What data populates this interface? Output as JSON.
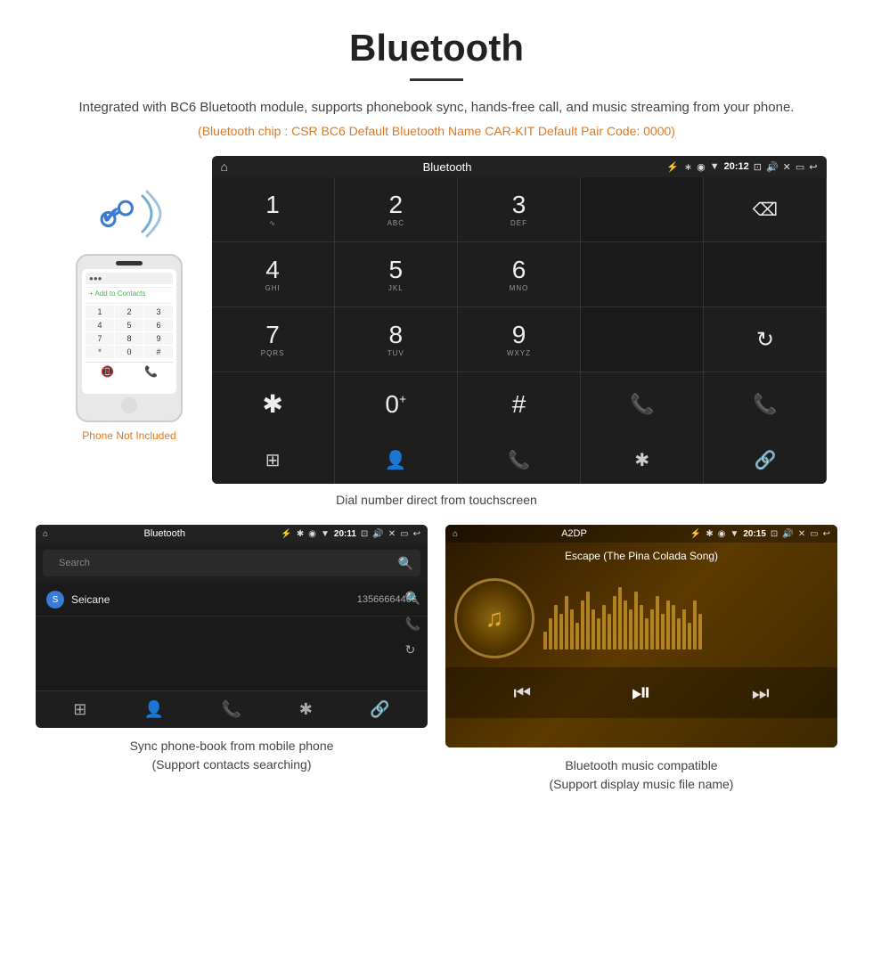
{
  "page": {
    "title": "Bluetooth",
    "subtitle": "Integrated with BC6 Bluetooth module, supports phonebook sync, hands-free call, and music streaming from your phone.",
    "specs": "(Bluetooth chip : CSR BC6    Default Bluetooth Name CAR-KIT    Default Pair Code: 0000)",
    "dial_caption": "Dial number direct from touchscreen",
    "phonebook_caption": "Sync phone-book from mobile phone\n(Support contacts searching)",
    "music_caption": "Bluetooth music compatible\n(Support display music file name)"
  },
  "phone_mockup": {
    "not_included_label": "Phone Not Included"
  },
  "dial_screen": {
    "status_title": "Bluetooth",
    "time": "20:12",
    "keys": [
      {
        "num": "1",
        "sub": ""
      },
      {
        "num": "2",
        "sub": "ABC"
      },
      {
        "num": "3",
        "sub": "DEF"
      },
      {
        "num": "",
        "sub": ""
      },
      {
        "num": "⌫",
        "sub": ""
      },
      {
        "num": "4",
        "sub": "GHI"
      },
      {
        "num": "5",
        "sub": "JKL"
      },
      {
        "num": "6",
        "sub": "MNO"
      },
      {
        "num": "",
        "sub": ""
      },
      {
        "num": "",
        "sub": ""
      },
      {
        "num": "7",
        "sub": "PQRS"
      },
      {
        "num": "8",
        "sub": "TUV"
      },
      {
        "num": "9",
        "sub": "WXYZ"
      },
      {
        "num": "",
        "sub": ""
      },
      {
        "num": "↻",
        "sub": ""
      },
      {
        "num": "*",
        "sub": ""
      },
      {
        "num": "0",
        "sub": "+"
      },
      {
        "num": "#",
        "sub": ""
      },
      {
        "num": "📞",
        "sub": "green"
      },
      {
        "num": "📞",
        "sub": "red"
      }
    ],
    "bottom_icons": [
      "⊞",
      "👤",
      "📞",
      "✱",
      "🔗"
    ]
  },
  "phonebook_screen": {
    "status_title": "Bluetooth",
    "time": "20:11",
    "search_placeholder": "Search",
    "contact_letter": "S",
    "contact_name": "Seicane",
    "contact_number": "13566664466",
    "bottom_icons": [
      "⊞",
      "👤",
      "📞",
      "✱",
      "🔗"
    ]
  },
  "music_screen": {
    "status_title": "A2DP",
    "time": "20:15",
    "song_title": "Escape (The Pina Colada Song)",
    "visualizer_bars": [
      20,
      35,
      50,
      40,
      60,
      45,
      30,
      55,
      65,
      45,
      35,
      50,
      40,
      60,
      70,
      55,
      45,
      65,
      50,
      35,
      45,
      60,
      40,
      55,
      50,
      35,
      45,
      30,
      55,
      40
    ]
  }
}
